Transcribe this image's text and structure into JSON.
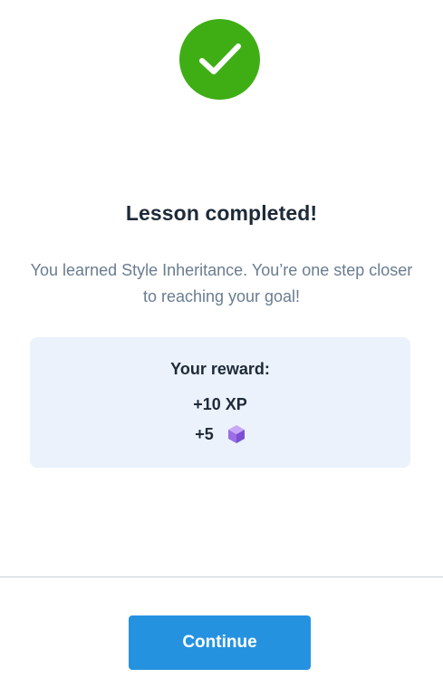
{
  "status_icon": "checkmark-circle-icon",
  "colors": {
    "success": "#3fae14",
    "accent": "#2592e0",
    "reward_bg": "#ebf2fc",
    "title_text": "#1e2a38",
    "muted_text": "#6a7c90"
  },
  "lesson": {
    "title": "Lesson completed!",
    "message": "You learned Style Inheritance. You’re one step closer to reaching your goal!"
  },
  "reward": {
    "heading": "Your reward:",
    "xp": "+10 XP",
    "gems": "+5",
    "gem_icon": "gem-cube-icon"
  },
  "footer": {
    "continue_label": "Continue"
  }
}
